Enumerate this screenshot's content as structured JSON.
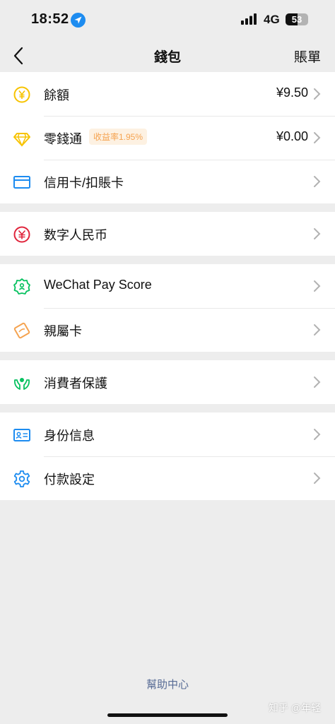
{
  "status_bar": {
    "time": "18:52",
    "network": "4G",
    "battery": "53",
    "battery_level_pct": 53
  },
  "nav": {
    "title": "錢包",
    "right_link": "賬單"
  },
  "groups": [
    {
      "items": [
        {
          "label": "餘額",
          "value": "¥9.50",
          "icon": "yuan-coin-icon"
        },
        {
          "label": "零錢通",
          "badge": "收益率1.95%",
          "value": "¥0.00",
          "icon": "diamond-icon"
        },
        {
          "label": "信用卡/扣賬卡",
          "icon": "card-icon"
        }
      ]
    },
    {
      "items": [
        {
          "label": "数字人民币",
          "icon": "digital-rmb-icon"
        }
      ]
    },
    {
      "items": [
        {
          "label": "WeChat Pay Score",
          "icon": "pay-score-icon"
        },
        {
          "label": "親屬卡",
          "icon": "family-card-icon"
        }
      ]
    },
    {
      "items": [
        {
          "label": "消費者保護",
          "icon": "protection-hands-icon"
        }
      ]
    },
    {
      "items": [
        {
          "label": "身份信息",
          "icon": "id-card-icon"
        },
        {
          "label": "付款設定",
          "icon": "settings-gear-icon"
        }
      ]
    }
  ],
  "footer": {
    "help": "幫助中心",
    "watermark": "知乎 @年轻"
  },
  "colors": {
    "background": "#ededed",
    "link": "#576b95",
    "badge_text": "#f5a350",
    "green": "#07c160",
    "blue": "#1d8cf0",
    "yellow": "#f7c300"
  }
}
